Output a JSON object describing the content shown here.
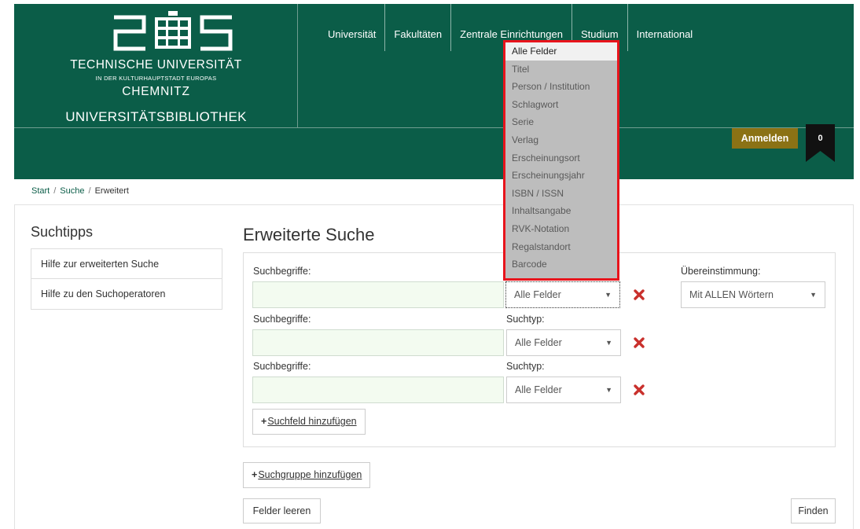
{
  "colors": {
    "header_bg": "#0b5d48",
    "login_bg": "#8b7215",
    "highlight": "#e8141c",
    "remove": "#c9302c"
  },
  "header": {
    "logo_title": "TECHNISCHE UNIVERSITÄT",
    "logo_subtitle": "IN DER KULTURHAUPTSTADT EUROPAS",
    "logo_city": "CHEMNITZ",
    "library": "UNIVERSITÄTSBIBLIOTHEK",
    "nav": [
      "Universität",
      "Fakultäten",
      "Zentrale Einrichtungen",
      "Studium",
      "International"
    ],
    "login_label": "Anmelden",
    "cart_count": "0"
  },
  "breadcrumb": {
    "items": [
      "Start",
      "Suche",
      "Erweitert"
    ],
    "separator": "/"
  },
  "sidebar": {
    "title": "Suchtipps",
    "items": [
      "Hilfe zur erweiterten Suche",
      "Hilfe zu den Suchoperatoren"
    ]
  },
  "main": {
    "title": "Erweiterte Suche",
    "terms_label": "Suchbegriffe:",
    "type_label": "Suchtyp:",
    "match_label": "Übereinstimmung:",
    "rows": [
      {
        "term": "",
        "type": "Alle Felder"
      },
      {
        "term": "",
        "type": "Alle Felder"
      },
      {
        "term": "",
        "type": "Alle Felder"
      }
    ],
    "match_value": "Mit ALLEN Wörtern",
    "add_field": "Suchfeld hinzufügen",
    "add_group": "Suchgruppe hinzufügen",
    "clear": "Felder leeren",
    "find": "Finden"
  },
  "dropdown": {
    "selected": "Alle Felder",
    "options": [
      "Alle Felder",
      "Titel",
      "Person / Institution",
      "Schlagwort",
      "Serie",
      "Verlag",
      "Erscheinungsort",
      "Erscheinungsjahr",
      "ISBN / ISSN",
      "Inhaltsangabe",
      "RVK-Notation",
      "Regalstandort",
      "Barcode"
    ]
  }
}
